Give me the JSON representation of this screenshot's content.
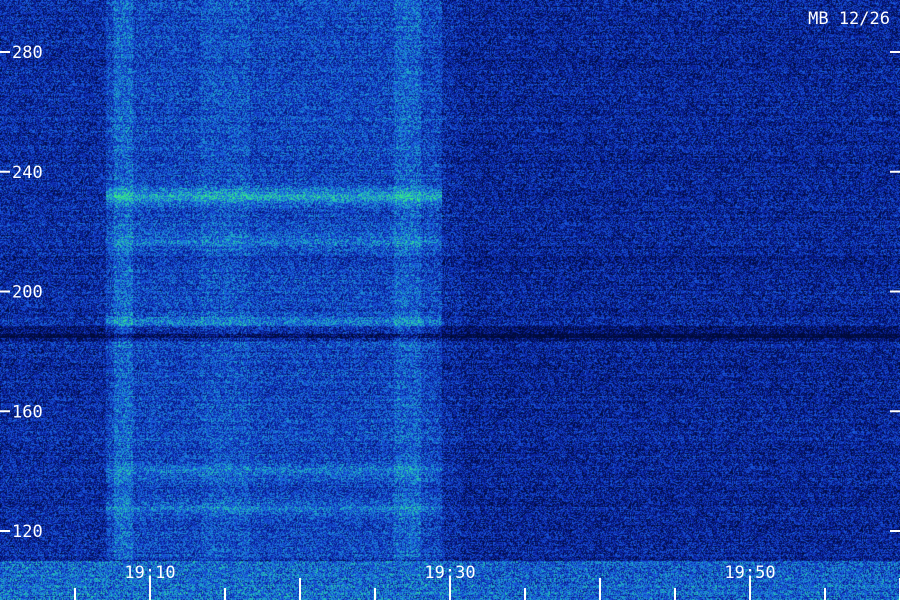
{
  "chart_data": {
    "type": "heatmap",
    "title": "",
    "station_label": "MB 12/26",
    "xlabel": "",
    "ylabel": "",
    "y_ticks": [
      120,
      160,
      200,
      240,
      280
    ],
    "y_range": [
      112,
      298
    ],
    "x_ticks": [
      "19:10",
      "19:30",
      "19:50"
    ],
    "x_range_minutes": [
      "19:05",
      "20:05"
    ],
    "colormap": [
      "#000a3a",
      "#0a1fa0",
      "#1a5ae0",
      "#1fb0c8",
      "#3cf07a"
    ],
    "bright_bands_mhz": [
      232,
      217,
      190,
      140,
      128
    ],
    "burst_interval": [
      "19:07",
      "19:30"
    ],
    "grid": false
  }
}
